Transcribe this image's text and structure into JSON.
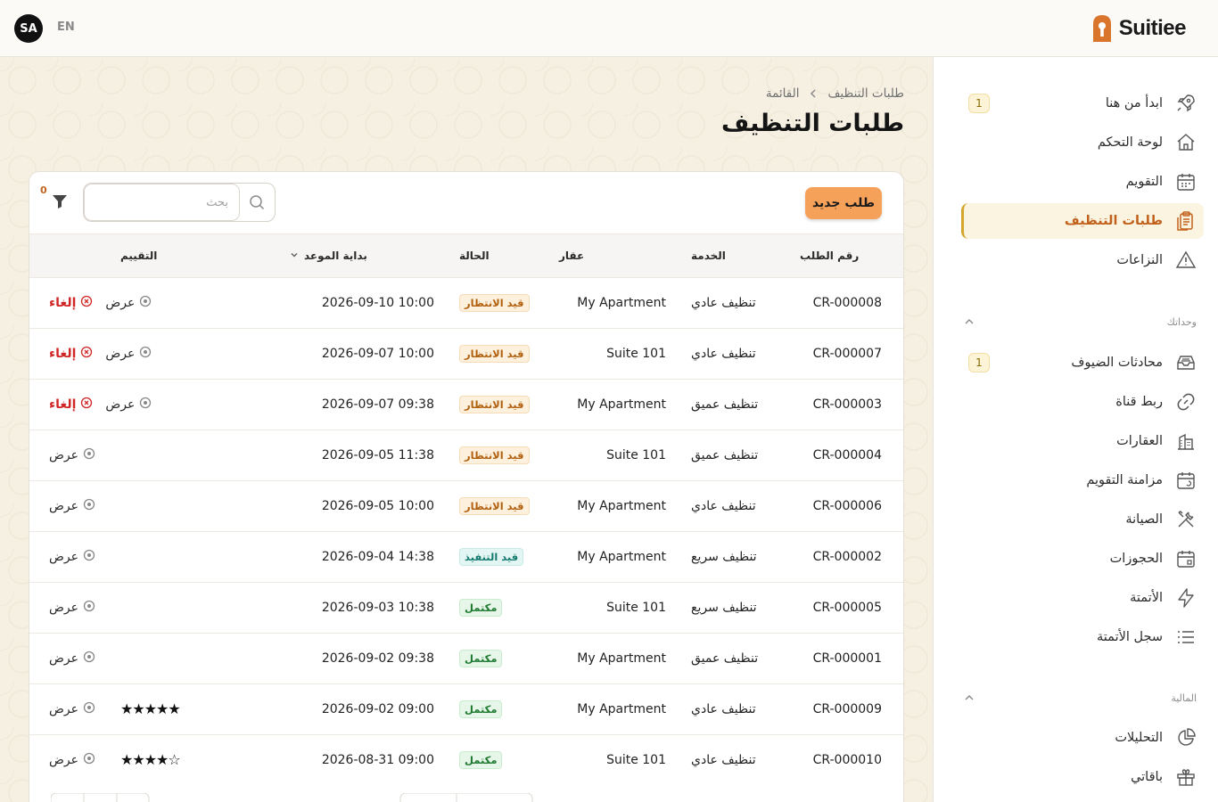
{
  "header": {
    "avatar": "SA",
    "language": "EN",
    "brand_name": "Suitiee"
  },
  "breadcrumb": {
    "parent": "طلبات التنظيف",
    "current": "القائمة"
  },
  "page": {
    "title": "طلبات التنظيف"
  },
  "toolbar": {
    "new_button": "طلب جديد",
    "search_placeholder": "بحث",
    "filter_count": "0"
  },
  "sidebar": {
    "items": [
      {
        "label": "ابدأ من هنا",
        "icon": "rocket-icon",
        "badge": "1"
      },
      {
        "label": "لوحة التحكم",
        "icon": "home-icon"
      },
      {
        "label": "التقويم",
        "icon": "calendar-icon"
      },
      {
        "label": "طلبات التنظيف",
        "icon": "clipboard-icon",
        "active": true
      },
      {
        "label": "النزاعات",
        "icon": "warning-icon"
      }
    ],
    "section_units": "وحداتك",
    "units_items": [
      {
        "label": "محادثات الضيوف",
        "icon": "inbox-icon",
        "badge": "1"
      },
      {
        "label": "ربط قناة",
        "icon": "link-icon"
      },
      {
        "label": "العقارات",
        "icon": "building-icon"
      },
      {
        "label": "مزامنة التقويم",
        "icon": "calendar-sync-icon"
      },
      {
        "label": "الصيانة",
        "icon": "tools-icon"
      },
      {
        "label": "الحجوزات",
        "icon": "calendar-check-icon"
      },
      {
        "label": "الأتمتة",
        "icon": "bolt-icon"
      },
      {
        "label": "سجل الأتمتة",
        "icon": "list-icon"
      }
    ],
    "section_finance": "المالية",
    "finance_items": [
      {
        "label": "التحليلات",
        "icon": "pie-chart-icon"
      },
      {
        "label": "باقاتي",
        "icon": "gift-icon"
      }
    ]
  },
  "table": {
    "headers": {
      "id": "رقم الطلب",
      "service": "الخدمة",
      "property": "عقار",
      "status": "الحالة",
      "start": "بداية الموعد",
      "rating": "التقييم"
    },
    "actions": {
      "view": "عرض",
      "cancel": "إلغاء"
    },
    "rows": [
      {
        "id": "CR-000008",
        "service": "تنظيف عادي",
        "property": "My Apartment",
        "status": "قيد الانتظار",
        "status_type": "pending",
        "start": "2026-09-10 10:00",
        "rating": "",
        "cancelable": true
      },
      {
        "id": "CR-000007",
        "service": "تنظيف عادي",
        "property": "Suite 101",
        "status": "قيد الانتظار",
        "status_type": "pending",
        "start": "2026-09-07 10:00",
        "rating": "",
        "cancelable": true
      },
      {
        "id": "CR-000003",
        "service": "تنظيف عميق",
        "property": "My Apartment",
        "status": "قيد الانتظار",
        "status_type": "pending",
        "start": "2026-09-07 09:38",
        "rating": "",
        "cancelable": true
      },
      {
        "id": "CR-000004",
        "service": "تنظيف عميق",
        "property": "Suite 101",
        "status": "قيد الانتظار",
        "status_type": "pending",
        "start": "2026-09-05 11:38",
        "rating": "",
        "cancelable": false
      },
      {
        "id": "CR-000006",
        "service": "تنظيف عادي",
        "property": "My Apartment",
        "status": "قيد الانتظار",
        "status_type": "pending",
        "start": "2026-09-05 10:00",
        "rating": "",
        "cancelable": false
      },
      {
        "id": "CR-000002",
        "service": "تنظيف سريع",
        "property": "My Apartment",
        "status": "قيد التنفيذ",
        "status_type": "progress",
        "start": "2026-09-04 14:38",
        "rating": "",
        "cancelable": false
      },
      {
        "id": "CR-000005",
        "service": "تنظيف سريع",
        "property": "Suite 101",
        "status": "مكتمل",
        "status_type": "done",
        "start": "2026-09-03 10:38",
        "rating": "",
        "cancelable": false
      },
      {
        "id": "CR-000001",
        "service": "تنظيف عميق",
        "property": "My Apartment",
        "status": "مكتمل",
        "status_type": "done",
        "start": "2026-09-02 09:38",
        "rating": "",
        "cancelable": false
      },
      {
        "id": "CR-000009",
        "service": "تنظيف عادي",
        "property": "My Apartment",
        "status": "مكتمل",
        "status_type": "done",
        "start": "2026-09-02 09:00",
        "rating": "★★★★★",
        "cancelable": false
      },
      {
        "id": "CR-000010",
        "service": "تنظيف عادي",
        "property": "Suite 101",
        "status": "مكتمل",
        "status_type": "done",
        "start": "2026-08-31 09:00",
        "rating": "☆★★★★",
        "cancelable": false
      }
    ]
  },
  "colors": {
    "accent": "#f6a15a",
    "active_text": "#c2611b",
    "cancel": "#d02626"
  }
}
